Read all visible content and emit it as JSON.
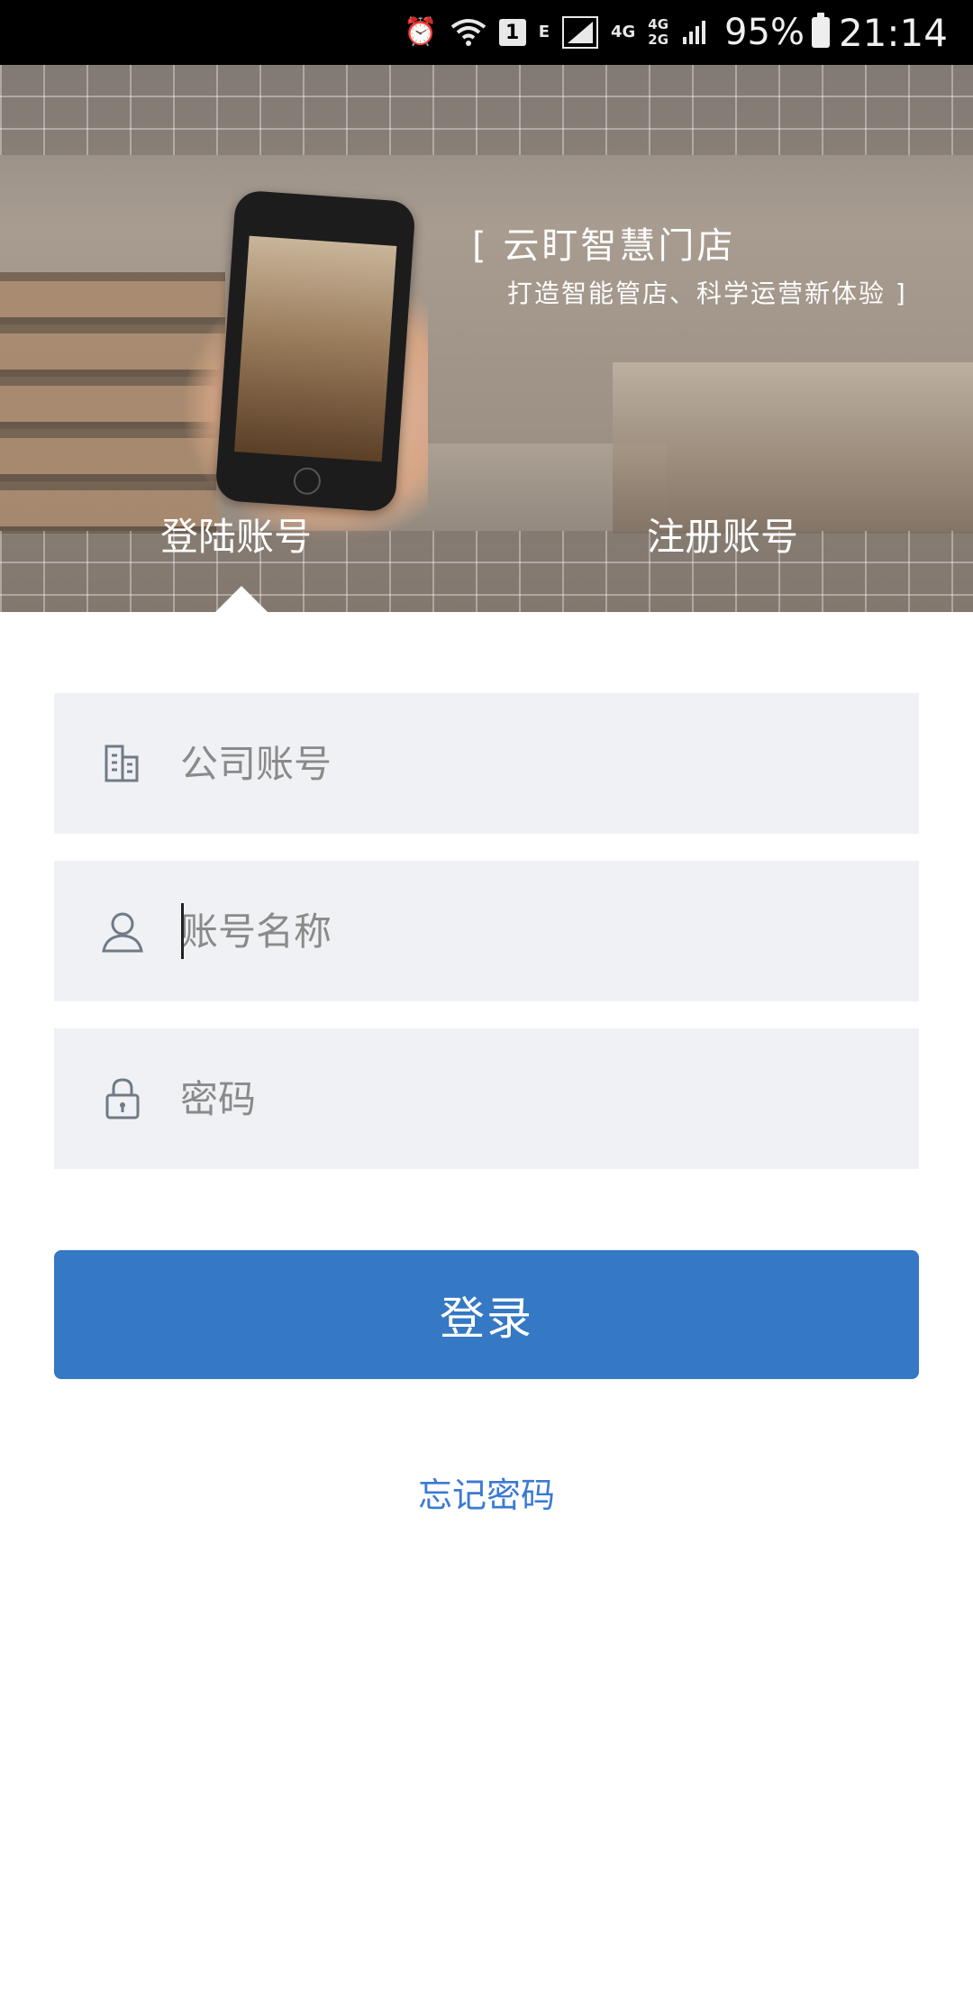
{
  "status_bar": {
    "battery": "95%",
    "time": "21:14",
    "sim_badge": "1",
    "network_e": "E",
    "network_4g": "4G",
    "network_4g2": "4G",
    "network_2g": "2G",
    "icons": [
      "alarm-icon",
      "wifi-icon",
      "sim-icon",
      "signal-icon",
      "battery-icon"
    ]
  },
  "banner": {
    "title": "[  云盯智慧门店",
    "subtitle": "打造智能管店、科学运营新体验  ]",
    "tabs": [
      {
        "label": "登陆账号",
        "selected": true
      },
      {
        "label": "注册账号",
        "selected": false
      }
    ]
  },
  "form": {
    "company": {
      "placeholder": "公司账号",
      "value": "",
      "icon": "building-icon"
    },
    "account": {
      "placeholder": "账号名称",
      "value": "",
      "icon": "user-icon"
    },
    "password": {
      "placeholder": "密码",
      "value": "",
      "icon": "lock-icon"
    },
    "login_label": "登录",
    "forgot_label": "忘记密码"
  },
  "colors": {
    "primary": "#3578c4",
    "link": "#3b7ad3",
    "field_bg": "#f0f1f4"
  }
}
